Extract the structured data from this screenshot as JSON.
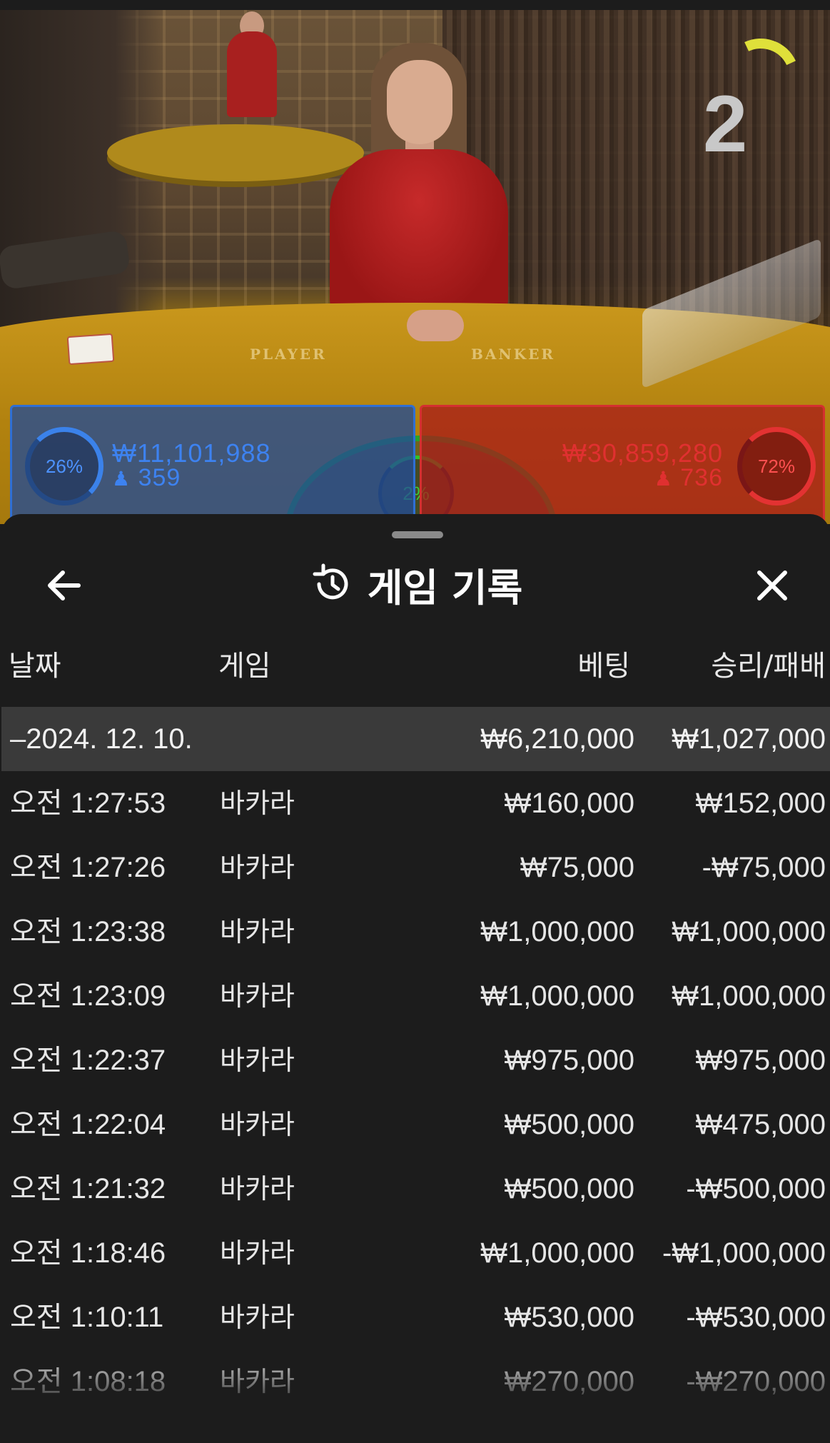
{
  "video": {
    "round_number": "2",
    "felt_labels": {
      "player": "PLAYER",
      "banker": "BANKER"
    },
    "player_panel": {
      "percent": "26%",
      "amount": "₩11,101,988",
      "count": "359"
    },
    "tie_panel": {
      "percent": "2%"
    },
    "banker_panel": {
      "percent": "72%",
      "amount": "₩30,859,280",
      "count": "736"
    },
    "colors": {
      "player": "#2f6fd4",
      "banker": "#d43030",
      "tie": "#2aa12a"
    }
  },
  "sheet": {
    "title": "게임 기록",
    "title_icon": "history-icon",
    "back_icon": "arrow-left-icon",
    "close_icon": "close-icon",
    "columns": {
      "date": "날짜",
      "game": "게임",
      "bet": "베팅",
      "win_loss": "승리/패배"
    },
    "date_group": {
      "label": "–2024. 12. 10.",
      "bet_total": "₩6,210,000",
      "win_total": "₩1,027,000"
    },
    "rows": [
      {
        "time": "오전 1:27:53",
        "game": "바카라",
        "bet": "₩160,000",
        "result": "₩152,000"
      },
      {
        "time": "오전 1:27:26",
        "game": "바카라",
        "bet": "₩75,000",
        "result": "-₩75,000"
      },
      {
        "time": "오전 1:23:38",
        "game": "바카라",
        "bet": "₩1,000,000",
        "result": "₩1,000,000"
      },
      {
        "time": "오전 1:23:09",
        "game": "바카라",
        "bet": "₩1,000,000",
        "result": "₩1,000,000"
      },
      {
        "time": "오전 1:22:37",
        "game": "바카라",
        "bet": "₩975,000",
        "result": "₩975,000"
      },
      {
        "time": "오전 1:22:04",
        "game": "바카라",
        "bet": "₩500,000",
        "result": "₩475,000"
      },
      {
        "time": "오전 1:21:32",
        "game": "바카라",
        "bet": "₩500,000",
        "result": "-₩500,000"
      },
      {
        "time": "오전 1:18:46",
        "game": "바카라",
        "bet": "₩1,000,000",
        "result": "-₩1,000,000"
      },
      {
        "time": "오전 1:10:11",
        "game": "바카라",
        "bet": "₩530,000",
        "result": "-₩530,000"
      },
      {
        "time": "오전 1:08:18",
        "game": "바카라",
        "bet": "₩270,000",
        "result": "-₩270,000"
      }
    ]
  }
}
